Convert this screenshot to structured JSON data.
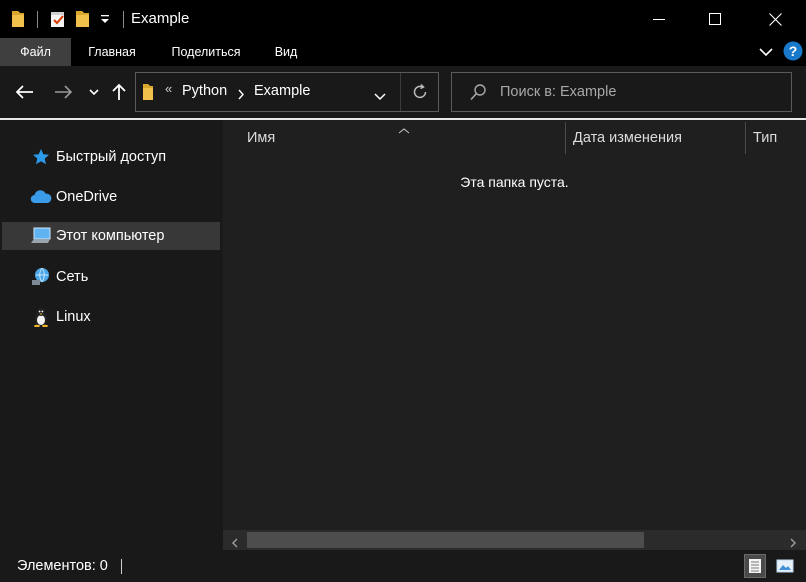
{
  "window": {
    "title": "Example",
    "controls": [
      "minimize-icon",
      "maximize-icon",
      "close-icon"
    ]
  },
  "ribbon": {
    "tabs": [
      {
        "label": "Файл",
        "active": true
      },
      {
        "label": "Главная",
        "active": false
      },
      {
        "label": "Поделиться",
        "active": false
      },
      {
        "label": "Вид",
        "active": false
      }
    ]
  },
  "navigation": {
    "breadcrumb_overflow": "«",
    "breadcrumbs": [
      "Python",
      "Example"
    ],
    "search_placeholder": "Поиск в: Example"
  },
  "sidebar": {
    "items": [
      {
        "label": "Быстрый доступ",
        "icon": "star-icon",
        "selected": false
      },
      {
        "label": "OneDrive",
        "icon": "cloud-icon",
        "selected": false
      },
      {
        "label": "Этот компьютер",
        "icon": "computer-icon",
        "selected": true
      },
      {
        "label": "Сеть",
        "icon": "network-icon",
        "selected": false
      },
      {
        "label": "Linux",
        "icon": "linux-penguin-icon",
        "selected": false
      }
    ]
  },
  "content": {
    "columns": [
      "Имя",
      "Дата изменения",
      "Тип"
    ],
    "empty_message": "Эта папка пуста."
  },
  "statusbar": {
    "items_text": "Элементов: 0"
  },
  "colors": {
    "background": "#000000",
    "panel": "#191919",
    "content": "#1f1f1f",
    "selected": "#383838",
    "accent": "#0078d7"
  }
}
